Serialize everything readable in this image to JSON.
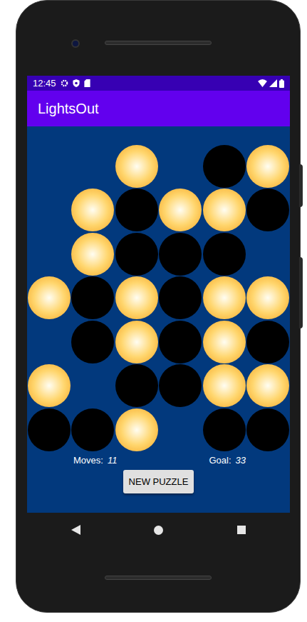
{
  "status_bar": {
    "time": "12:45"
  },
  "app_bar": {
    "title": "LightsOut"
  },
  "board": {
    "rows": [
      [
        {
          "kind": "empty"
        },
        {
          "kind": "empty"
        },
        {
          "kind": "light",
          "on": true
        },
        {
          "kind": "empty"
        },
        {
          "kind": "light",
          "on": false
        },
        {
          "kind": "light",
          "on": true
        }
      ],
      [
        {
          "kind": "empty"
        },
        {
          "kind": "light",
          "on": true
        },
        {
          "kind": "light",
          "on": false
        },
        {
          "kind": "light",
          "on": true
        },
        {
          "kind": "light",
          "on": true
        },
        {
          "kind": "light",
          "on": false
        }
      ],
      [
        {
          "kind": "empty"
        },
        {
          "kind": "light",
          "on": true
        },
        {
          "kind": "light",
          "on": false
        },
        {
          "kind": "light",
          "on": false
        },
        {
          "kind": "light",
          "on": false
        },
        {
          "kind": "empty"
        }
      ],
      [
        {
          "kind": "light",
          "on": true
        },
        {
          "kind": "light",
          "on": false
        },
        {
          "kind": "light",
          "on": true
        },
        {
          "kind": "light",
          "on": false
        },
        {
          "kind": "light",
          "on": true
        },
        {
          "kind": "light",
          "on": true
        }
      ],
      [
        {
          "kind": "empty"
        },
        {
          "kind": "light",
          "on": false
        },
        {
          "kind": "light",
          "on": true
        },
        {
          "kind": "light",
          "on": false
        },
        {
          "kind": "light",
          "on": true
        },
        {
          "kind": "light",
          "on": false
        }
      ],
      [
        {
          "kind": "light",
          "on": true
        },
        {
          "kind": "empty"
        },
        {
          "kind": "light",
          "on": false
        },
        {
          "kind": "light",
          "on": false
        },
        {
          "kind": "light",
          "on": true
        },
        {
          "kind": "light",
          "on": true
        }
      ],
      [
        {
          "kind": "light",
          "on": false
        },
        {
          "kind": "light",
          "on": false
        },
        {
          "kind": "light",
          "on": true
        },
        {
          "kind": "empty"
        },
        {
          "kind": "light",
          "on": false
        },
        {
          "kind": "light",
          "on": false
        }
      ]
    ]
  },
  "moves": {
    "label": "Moves:",
    "value": "11"
  },
  "goal": {
    "label": "Goal:",
    "value": "33"
  },
  "buttons": [
    "NEW PUZZLE"
  ]
}
